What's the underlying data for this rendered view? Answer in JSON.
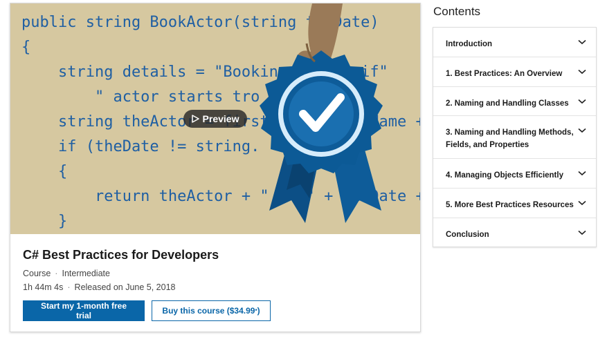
{
  "hero": {
    "code_lines": [
      "public string BookActor(string theDate)",
      "{",
      "    string details = \"Booking change if\"",
      "        \" actor starts tro",
      "    string theActor = firstName + lastName +",
      "    if (theDate != string.",
      "    {",
      "        return theActor + \" on \" + theDate +",
      "    }"
    ],
    "preview_label": "Preview",
    "colors": {
      "background": "#d6c8a0",
      "code": "#1f5fa3",
      "ribbon": "#0c5a96",
      "badge": "#1a6fb0"
    }
  },
  "course": {
    "title": "C# Best Practices for Developers",
    "type": "Course",
    "level": "Intermediate",
    "duration": "1h 44m 4s",
    "released": "Released on June 5, 2018",
    "separator": "·"
  },
  "actions": {
    "trial_label": "Start my 1-month free trial",
    "buy_label": "Buy this course ($34.99",
    "buy_suffix": "*",
    "buy_close": ")"
  },
  "contents": {
    "title": "Contents",
    "items": [
      {
        "label": "Introduction"
      },
      {
        "label": "1. Best Practices: An Overview"
      },
      {
        "label": "2. Naming and Handling Classes"
      },
      {
        "label": "3. Naming and Handling Methods, Fields, and Properties"
      },
      {
        "label": "4. Managing Objects Efficiently"
      },
      {
        "label": "5. More Best Practices Resources"
      },
      {
        "label": "Conclusion"
      }
    ]
  }
}
